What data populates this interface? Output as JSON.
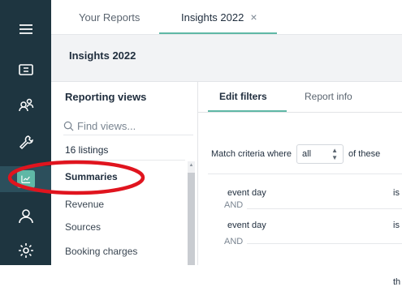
{
  "top_tabs": [
    {
      "label": "Your Reports"
    },
    {
      "label": "Insights 2022",
      "close": "×"
    }
  ],
  "header": {
    "title": "Insights 2022"
  },
  "left_pane": {
    "title": "Reporting views",
    "search_placeholder": "Find views...",
    "count": "16 listings",
    "items": [
      "Summaries",
      "Revenue",
      "Sources",
      "Booking charges"
    ],
    "selected": "Summaries"
  },
  "right_pane": {
    "tabs": [
      "Edit filters",
      "Report info"
    ],
    "match_prefix": "Match criteria where",
    "match_value": "all",
    "match_suffix": "of these",
    "rules": [
      {
        "field": "event day",
        "op": "is",
        "joiner": "AND"
      },
      {
        "field": "event day",
        "op": "is",
        "joiner": "AND"
      }
    ],
    "trailing": "th"
  },
  "sidebar_icons": [
    "menu-icon",
    "ticket-icon",
    "users-icon",
    "wrench-icon",
    "reports-icon",
    "user-icon",
    "gear-icon"
  ],
  "colors": {
    "rail": "#1e3540",
    "accent": "#5fb8a6",
    "annotation": "#e0141e"
  }
}
